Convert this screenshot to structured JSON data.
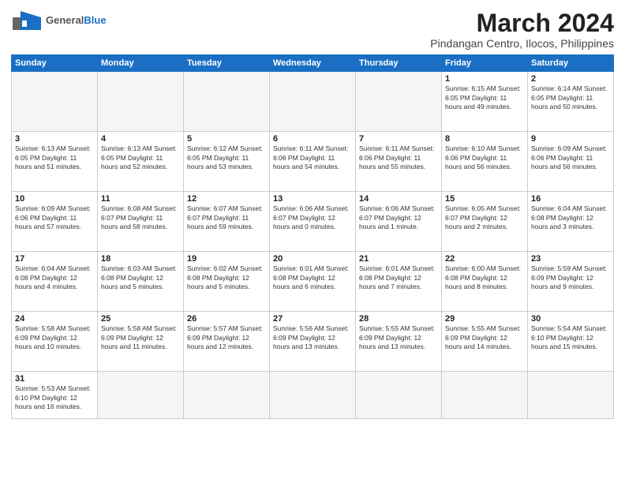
{
  "header": {
    "logo_general": "General",
    "logo_blue": "Blue",
    "title": "March 2024",
    "subtitle": "Pindangan Centro, Ilocos, Philippines"
  },
  "days_of_week": [
    "Sunday",
    "Monday",
    "Tuesday",
    "Wednesday",
    "Thursday",
    "Friday",
    "Saturday"
  ],
  "weeks": [
    [
      {
        "day": "",
        "info": ""
      },
      {
        "day": "",
        "info": ""
      },
      {
        "day": "",
        "info": ""
      },
      {
        "day": "",
        "info": ""
      },
      {
        "day": "",
        "info": ""
      },
      {
        "day": "1",
        "info": "Sunrise: 6:15 AM\nSunset: 6:05 PM\nDaylight: 11 hours\nand 49 minutes."
      },
      {
        "day": "2",
        "info": "Sunrise: 6:14 AM\nSunset: 6:05 PM\nDaylight: 11 hours\nand 50 minutes."
      }
    ],
    [
      {
        "day": "3",
        "info": "Sunrise: 6:13 AM\nSunset: 6:05 PM\nDaylight: 11 hours\nand 51 minutes."
      },
      {
        "day": "4",
        "info": "Sunrise: 6:13 AM\nSunset: 6:05 PM\nDaylight: 11 hours\nand 52 minutes."
      },
      {
        "day": "5",
        "info": "Sunrise: 6:12 AM\nSunset: 6:05 PM\nDaylight: 11 hours\nand 53 minutes."
      },
      {
        "day": "6",
        "info": "Sunrise: 6:11 AM\nSunset: 6:06 PM\nDaylight: 11 hours\nand 54 minutes."
      },
      {
        "day": "7",
        "info": "Sunrise: 6:11 AM\nSunset: 6:06 PM\nDaylight: 11 hours\nand 55 minutes."
      },
      {
        "day": "8",
        "info": "Sunrise: 6:10 AM\nSunset: 6:06 PM\nDaylight: 11 hours\nand 56 minutes."
      },
      {
        "day": "9",
        "info": "Sunrise: 6:09 AM\nSunset: 6:06 PM\nDaylight: 11 hours\nand 56 minutes."
      }
    ],
    [
      {
        "day": "10",
        "info": "Sunrise: 6:09 AM\nSunset: 6:06 PM\nDaylight: 11 hours\nand 57 minutes."
      },
      {
        "day": "11",
        "info": "Sunrise: 6:08 AM\nSunset: 6:07 PM\nDaylight: 11 hours\nand 58 minutes."
      },
      {
        "day": "12",
        "info": "Sunrise: 6:07 AM\nSunset: 6:07 PM\nDaylight: 11 hours\nand 59 minutes."
      },
      {
        "day": "13",
        "info": "Sunrise: 6:06 AM\nSunset: 6:07 PM\nDaylight: 12 hours\nand 0 minutes."
      },
      {
        "day": "14",
        "info": "Sunrise: 6:06 AM\nSunset: 6:07 PM\nDaylight: 12 hours\nand 1 minute."
      },
      {
        "day": "15",
        "info": "Sunrise: 6:05 AM\nSunset: 6:07 PM\nDaylight: 12 hours\nand 2 minutes."
      },
      {
        "day": "16",
        "info": "Sunrise: 6:04 AM\nSunset: 6:08 PM\nDaylight: 12 hours\nand 3 minutes."
      }
    ],
    [
      {
        "day": "17",
        "info": "Sunrise: 6:04 AM\nSunset: 6:08 PM\nDaylight: 12 hours\nand 4 minutes."
      },
      {
        "day": "18",
        "info": "Sunrise: 6:03 AM\nSunset: 6:08 PM\nDaylight: 12 hours\nand 5 minutes."
      },
      {
        "day": "19",
        "info": "Sunrise: 6:02 AM\nSunset: 6:08 PM\nDaylight: 12 hours\nand 5 minutes."
      },
      {
        "day": "20",
        "info": "Sunrise: 6:01 AM\nSunset: 6:08 PM\nDaylight: 12 hours\nand 6 minutes."
      },
      {
        "day": "21",
        "info": "Sunrise: 6:01 AM\nSunset: 6:08 PM\nDaylight: 12 hours\nand 7 minutes."
      },
      {
        "day": "22",
        "info": "Sunrise: 6:00 AM\nSunset: 6:08 PM\nDaylight: 12 hours\nand 8 minutes."
      },
      {
        "day": "23",
        "info": "Sunrise: 5:59 AM\nSunset: 6:09 PM\nDaylight: 12 hours\nand 9 minutes."
      }
    ],
    [
      {
        "day": "24",
        "info": "Sunrise: 5:58 AM\nSunset: 6:09 PM\nDaylight: 12 hours\nand 10 minutes."
      },
      {
        "day": "25",
        "info": "Sunrise: 5:58 AM\nSunset: 6:09 PM\nDaylight: 12 hours\nand 11 minutes."
      },
      {
        "day": "26",
        "info": "Sunrise: 5:57 AM\nSunset: 6:09 PM\nDaylight: 12 hours\nand 12 minutes."
      },
      {
        "day": "27",
        "info": "Sunrise: 5:56 AM\nSunset: 6:09 PM\nDaylight: 12 hours\nand 13 minutes."
      },
      {
        "day": "28",
        "info": "Sunrise: 5:55 AM\nSunset: 6:09 PM\nDaylight: 12 hours\nand 13 minutes."
      },
      {
        "day": "29",
        "info": "Sunrise: 5:55 AM\nSunset: 6:09 PM\nDaylight: 12 hours\nand 14 minutes."
      },
      {
        "day": "30",
        "info": "Sunrise: 5:54 AM\nSunset: 6:10 PM\nDaylight: 12 hours\nand 15 minutes."
      }
    ],
    [
      {
        "day": "31",
        "info": "Sunrise: 5:53 AM\nSunset: 6:10 PM\nDaylight: 12 hours\nand 16 minutes."
      },
      {
        "day": "",
        "info": ""
      },
      {
        "day": "",
        "info": ""
      },
      {
        "day": "",
        "info": ""
      },
      {
        "day": "",
        "info": ""
      },
      {
        "day": "",
        "info": ""
      },
      {
        "day": "",
        "info": ""
      }
    ]
  ]
}
